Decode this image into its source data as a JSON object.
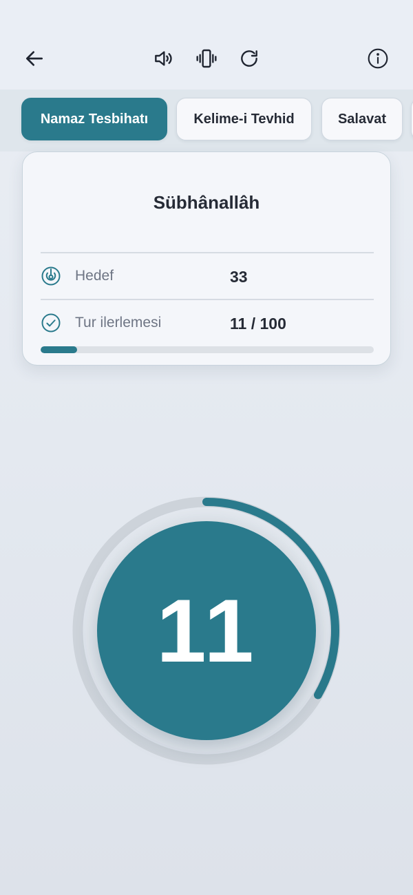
{
  "header": {
    "back_icon": "arrow-left-icon",
    "sound_icon": "volume-icon",
    "vibrate_icon": "vibrate-icon",
    "reset_icon": "refresh-icon",
    "info_icon": "info-icon"
  },
  "tabs": [
    {
      "label": "Namaz Tesbihatı",
      "active": true
    },
    {
      "label": "Kelime-i Tevhid",
      "active": false
    },
    {
      "label": "Salavat",
      "active": false
    }
  ],
  "card": {
    "title": "Sübhânallâh",
    "target_label": "Hedef",
    "target_value": "33",
    "progress_label": "Tur ilerlemesi",
    "progress_value": "11 / 100",
    "progress_fraction": 0.11
  },
  "counter": {
    "value": "11",
    "ring_fraction": 0.3333
  },
  "colors": {
    "accent": "#2a7a8c",
    "background": "#e6ebf1",
    "card": "#f4f6fa",
    "text_primary": "#262b36",
    "text_secondary": "#6e7584"
  }
}
